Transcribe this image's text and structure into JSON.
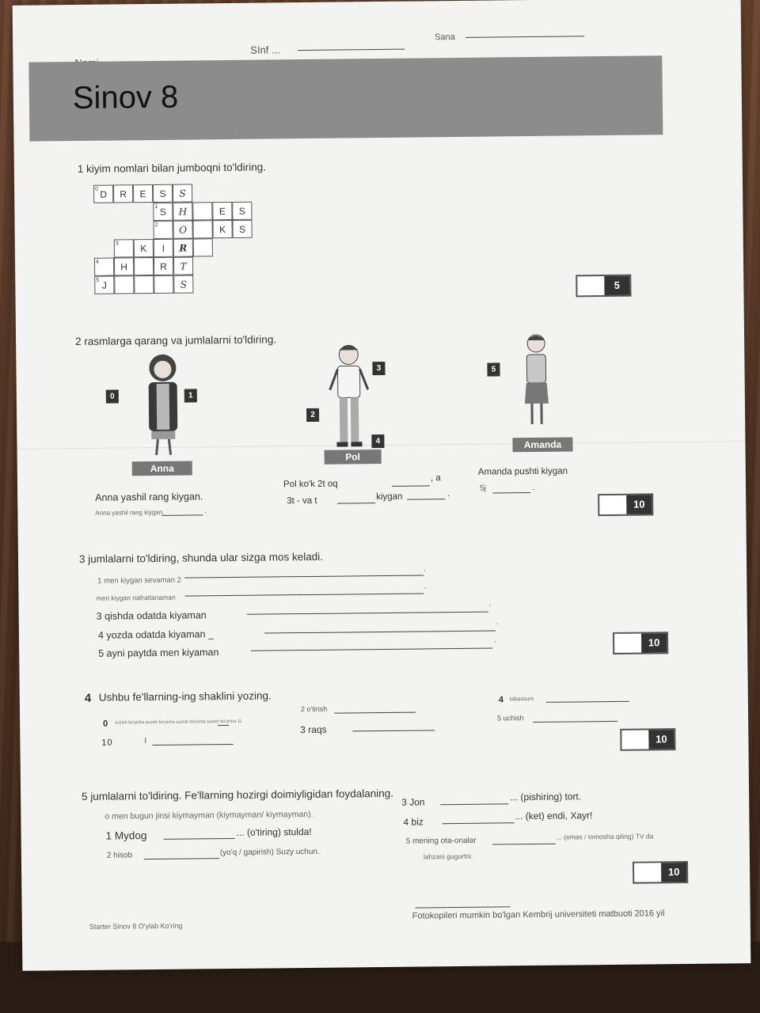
{
  "header": {
    "nomi": "Nomi",
    "sinf": "SInf ...",
    "sana": "Sana"
  },
  "title": "Sinov 8",
  "q1": {
    "prompt": "1 kiyim nomlari bilan jumboqni to'ldiring.",
    "score": "5",
    "numbers": [
      "0",
      "1",
      "2",
      "3",
      "4",
      "5"
    ],
    "letters": {
      "r0": [
        "D",
        "R",
        "E",
        "S",
        "S"
      ],
      "r1": [
        "S",
        "H",
        "E",
        "S"
      ],
      "r2": [
        "O",
        "K",
        "S"
      ],
      "r3": [
        "K",
        "I",
        "R"
      ],
      "r4": [
        "H",
        "R",
        "T"
      ],
      "r5": [
        "J",
        "S"
      ]
    }
  },
  "q2": {
    "prompt": "2 rasmlarga qarang va jumlalarni to'ldiring.",
    "score": "10",
    "names": {
      "anna": "Anna",
      "pol": "Pol",
      "amanda": "Amanda"
    },
    "tags": [
      "0",
      "1",
      "3",
      "2",
      "4",
      "5"
    ],
    "sentences": {
      "s0": "Anna yashil rang kiygan.",
      "s1": "Anna yashil rang kiygan.",
      "s1_end": ".",
      "pol_a": "Pol ko'k 2t oq",
      "pol_a_end": ", a",
      "pol_b": "3t - va t",
      "pol_b_mid": "kiygan",
      "pol_b_end": ".",
      "amanda_a": "Amanda pushti kiygan",
      "amanda_b": "5j",
      "amanda_b_end": "."
    }
  },
  "q3": {
    "prompt": "3 jumlalarni to'ldiring, shunda ular sizga mos keladi.",
    "score": "10",
    "items": [
      "1 men kiygan sevaman 2",
      "men kiygan nafratlanaman",
      "3 qishda odatda kiyaman",
      "4 yozda odatda kiyaman _",
      "5 ayni paytda men kiyaman"
    ],
    "ends": [
      ".",
      ".",
      ".",
      ".",
      "."
    ]
  },
  "q4": {
    "num": "4",
    "prompt": "Ushbu fe'llarning-ing shaklini yozing.",
    "score": "10",
    "zero": "0",
    "zero_text": "suzish bo'yicha suzish bo'yicha suzish bo'yicha suzish bo'yicha 11",
    "ten": "10",
    "ten_mark": "I",
    "two": "2 o'tirish",
    "three": "3 raqs",
    "four_num": "4",
    "four_text": "tabassum",
    "five": "5 uchish"
  },
  "q5": {
    "prompt": "5 jumlalarni to'ldiring. Fe'llarning hozirgi doimiyligidan foydalaning.",
    "score": "10",
    "example": "o men bugun jinsi kiymayman (kiymayman/ kiymayman).",
    "one_a": "1 Mydog",
    "one_b": "... (o'tiring) stulda!",
    "two_a": "2 hisob",
    "two_b": "(yo'q / gapirish) Suzy uchun.",
    "three_a": "3 Jon",
    "three_b": "... (pishiring) tort.",
    "four_a": "4 biz",
    "four_b": "... (ket) endi, Xayr!",
    "five_a": "5 mening ota-onalar",
    "five_b": "... (emas / tomosha qiling) TV da",
    "five_c": "lahzani gugurtni."
  },
  "footer": {
    "left": "Starter Sinov 8 O'ylab Ko'ring",
    "right": "Fotokopileri mumkin bo'lgan Kembrij universiteti matbuoti 2016 yil"
  }
}
